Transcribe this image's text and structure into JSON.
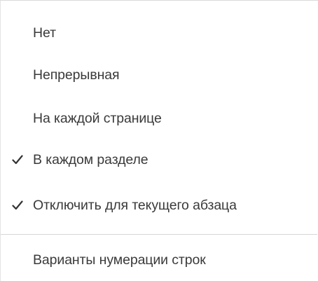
{
  "menu": {
    "items": [
      {
        "label": "Нет",
        "checked": false
      },
      {
        "label": "Непрерывная",
        "checked": false
      },
      {
        "label": "На каждой странице",
        "checked": false
      },
      {
        "label": "В каждом разделе",
        "checked": true
      },
      {
        "label": "Отключить для текущего абзаца",
        "checked": true
      }
    ],
    "footer_item": {
      "label": "Варианты нумерации строк"
    }
  },
  "colors": {
    "text": "#3a3a3a",
    "check": "#333333",
    "separator": "#d6d6d6"
  }
}
